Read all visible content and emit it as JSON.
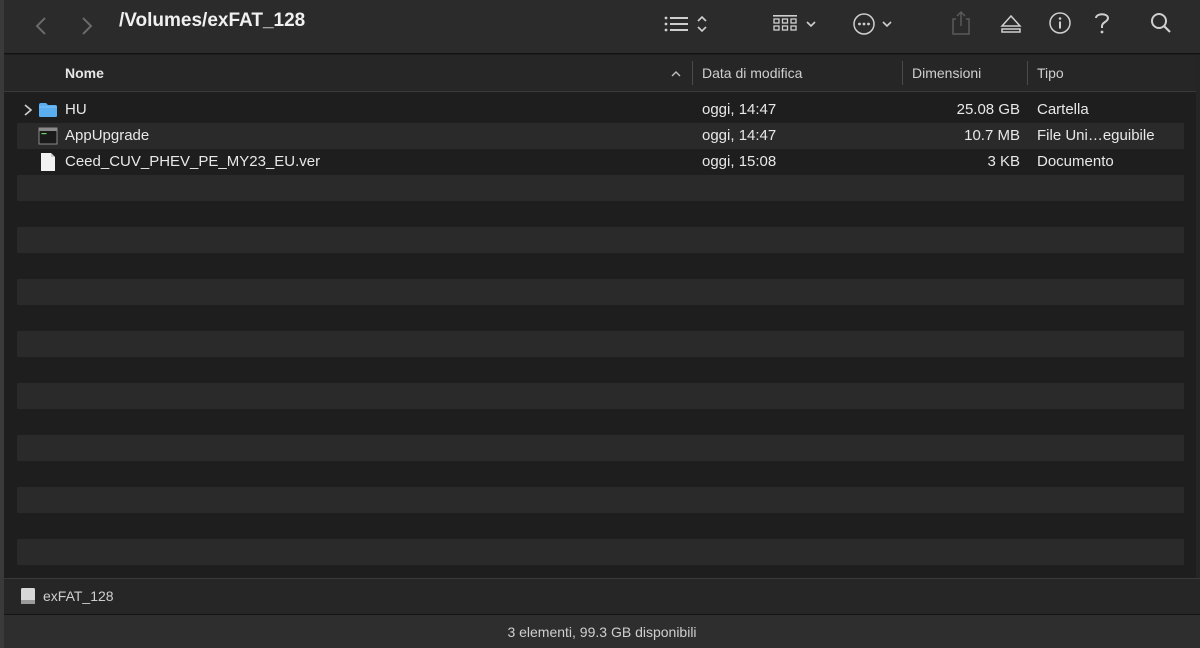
{
  "toolbar": {
    "path_title": "/Volumes/exFAT_128",
    "icons": [
      "chevron-left-icon",
      "chevron-right-icon",
      "list-view-icon",
      "grid-view-icon",
      "more-icon",
      "share-icon",
      "eject-icon",
      "info-icon",
      "help-icon",
      "search-icon"
    ]
  },
  "columns": {
    "name": "Nome",
    "modified": "Data di modifica",
    "size": "Dimensioni",
    "kind": "Tipo"
  },
  "files": [
    {
      "name": "HU",
      "modified": "oggi, 14:47",
      "size": "25.08 GB",
      "kind": "Cartella",
      "icon": "folder-icon",
      "expandable": true
    },
    {
      "name": "AppUpgrade",
      "modified": "oggi, 14:47",
      "size": "10.7 MB",
      "kind": "File Uni…eguibile",
      "icon": "executable-icon",
      "expandable": false
    },
    {
      "name": "Ceed_CUV_PHEV_PE_MY23_EU.ver",
      "modified": "oggi, 15:08",
      "size": "3 KB",
      "kind": "Documento",
      "icon": "document-icon",
      "expandable": false
    }
  ],
  "pathbar": {
    "volume_name": "exFAT_128"
  },
  "status": {
    "text": "3 elementi, 99.3 GB disponibili"
  },
  "colors": {
    "folder": "#5aaef0",
    "background": "#1e1e1e",
    "row_alt": "#2a2a2a"
  }
}
